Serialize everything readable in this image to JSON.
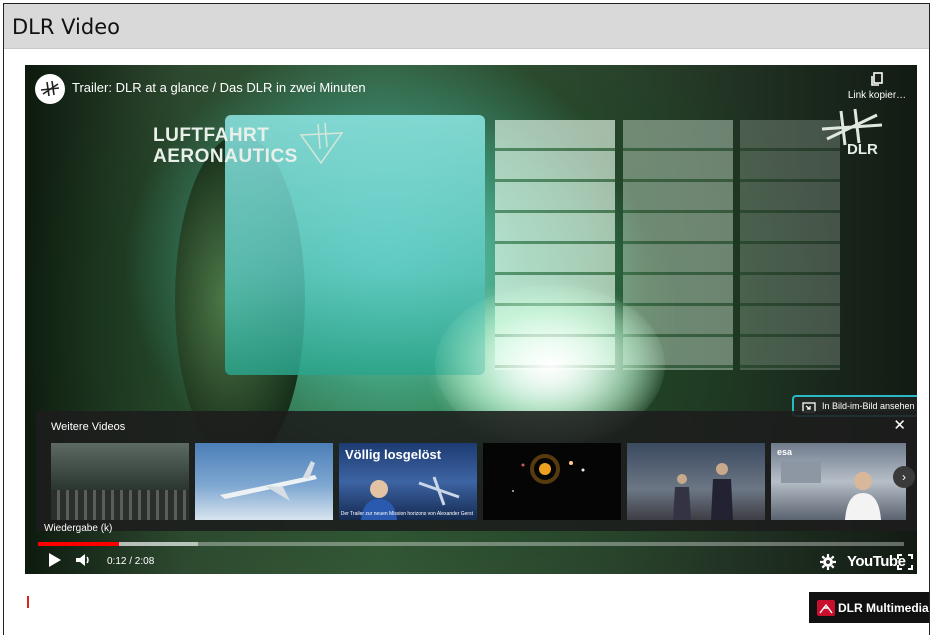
{
  "header": {
    "title": "DLR Video"
  },
  "player": {
    "video_title": "Trailer: DLR at a glance / Das DLR in zwei Minuten",
    "copy_link_label": "Link kopier…",
    "overlay_line1": "LUFTFAHRT",
    "overlay_line2": "AERONAUTICS",
    "watermark": "DLR",
    "pip_label": "In Bild-im-Bild ansehen",
    "more_videos_title": "Weitere Videos",
    "thumb3_caption": "Völlig losgelöst",
    "thumb3_sub": "Der Trailer zur neuen Mission horizons von Alexander Gerst",
    "thumb6_caption": "esa",
    "play_hint": "Wiedergabe (k)",
    "time": "0:12 / 2:08",
    "progress_fraction": 0.094,
    "youtube_label": "YouTube"
  },
  "footer": {
    "multimedia_label": "DLR Multimedia"
  }
}
